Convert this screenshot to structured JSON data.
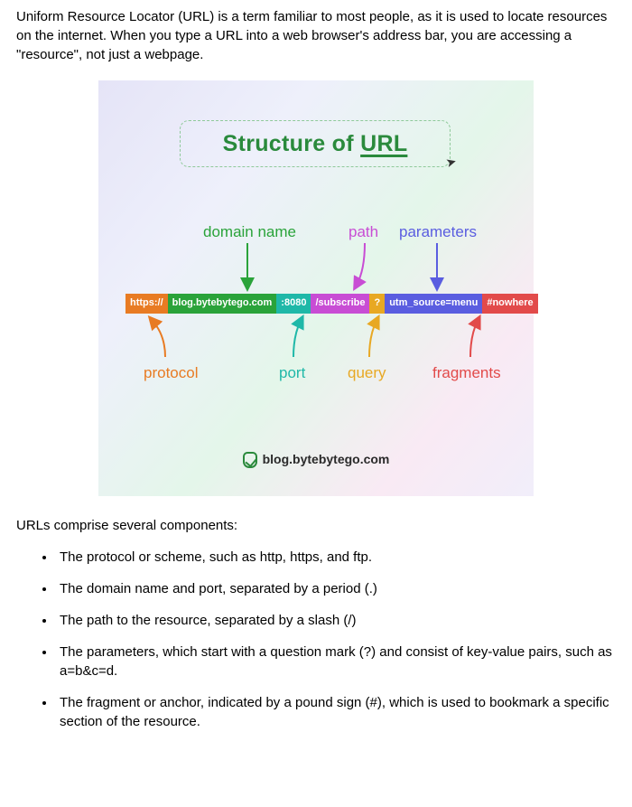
{
  "intro": "Uniform Resource Locator (URL) is a term familiar to most people, as it is used to locate resources on the internet. When you type a URL into a web browser's address bar, you are accessing a \"resource\", not just a webpage.",
  "diagram": {
    "title_prefix": "Structure of ",
    "title_ul": "URL",
    "labels_top": {
      "domain": "domain name",
      "path": "path",
      "parameters": "parameters"
    },
    "labels_bottom": {
      "protocol": "protocol",
      "port": "port",
      "query": "query",
      "fragments": "fragments"
    },
    "url": {
      "protocol": "https://",
      "domain": "blog.bytebytego.com",
      "port": ":8080",
      "path": "/subscribe",
      "qmark": "?",
      "params": "utm_source=menu",
      "fragment": "#nowhere"
    },
    "footer": "blog.bytebytego.com"
  },
  "subhead": "URLs comprise several components:",
  "bullets": [
    "The protocol or scheme, such as http, https, and ftp.",
    "The domain name and port, separated by a period (.)",
    "The path to the resource, separated by a slash (/)",
    "The parameters, which start with a question mark (?) and consist of key-value pairs, such as a=b&c=d.",
    "The fragment or anchor, indicated by a pound sign (#), which is used to bookmark a specific section of the resource."
  ],
  "colors": {
    "protocol": "#e87b23",
    "domain": "#2aa33a",
    "port": "#1fb8a8",
    "path": "#c84dd4",
    "query": "#e8a823",
    "params": "#5a5de0",
    "fragment": "#e24a4a"
  }
}
